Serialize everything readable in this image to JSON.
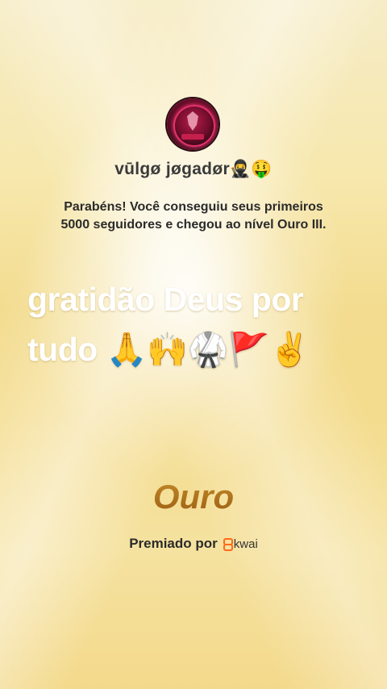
{
  "profile": {
    "avatar_icon": "gamer-avatar-icon",
    "username": "vūlgø jøgadør🥷🤑"
  },
  "achievement": {
    "message_line1": "Parabéns! Você conseguiu seus primeiros",
    "message_line2": "5000 seguidores e chegou ao nível Ouro III."
  },
  "caption": {
    "line1": "gratidão Deus por",
    "line2": "tudo 🙏🙌🥋🚩✌️"
  },
  "level": {
    "name": "Ouro",
    "color": "#b0741e"
  },
  "awarded": {
    "label": "Premiado por",
    "brand": "kwai",
    "brand_icon": "kwai-logo-icon",
    "brand_color": "#ff6a1a"
  }
}
